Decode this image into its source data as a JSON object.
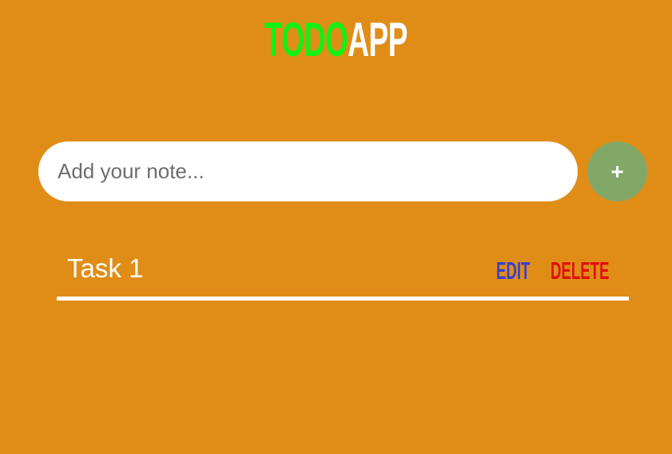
{
  "header": {
    "title_part1": "TODO",
    "title_part2": "APP"
  },
  "composer": {
    "placeholder": "Add your note...",
    "value": "",
    "add_label": "+"
  },
  "tasks": [
    {
      "text": "Task 1",
      "edit_label": "EDIT",
      "delete_label": "DELETE"
    }
  ],
  "colors": {
    "background": "#E08D18",
    "title_todo": "#13F013",
    "title_app": "#FFFFFF",
    "add_button": "#82A868",
    "edit": "#3B3FC9",
    "delete": "#E01010"
  }
}
